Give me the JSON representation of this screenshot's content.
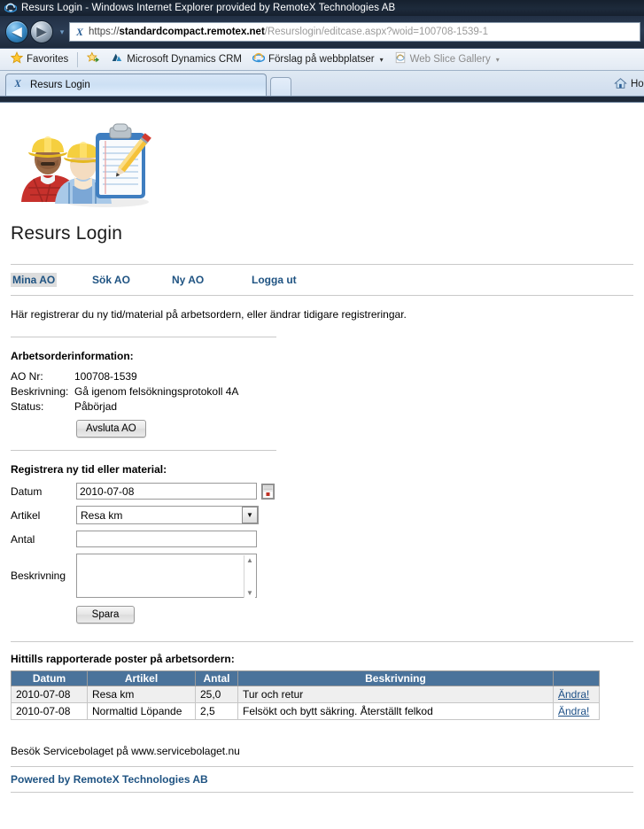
{
  "window": {
    "title": "Resurs Login - Windows Internet Explorer provided by RemoteX Technologies AB",
    "ie_icon": "internet-explorer-icon"
  },
  "toolbar": {
    "back_label": "◀",
    "forward_label": "▶",
    "history_caret": "▾",
    "address": {
      "scheme": "https://",
      "domain_prefix": "standardcompact.",
      "domain": "remotex.net",
      "path": "/Resurslogin/editcase.aspx?woid=100708-1539-1",
      "full_url": "https://standardcompact.remotex.net/Resurslogin/editcase.aspx?woid=100708-1539-1",
      "favicon_glyph": "X"
    }
  },
  "favorites_bar": {
    "favorites_label": "Favorites",
    "items": [
      {
        "label": "Microsoft Dynamics CRM",
        "icon": "dynamics-crm-icon",
        "has_caret": false,
        "dim": false
      },
      {
        "label": "Förslag på webbplatser",
        "icon": "internet-explorer-icon",
        "has_caret": true,
        "dim": false
      },
      {
        "label": "Web Slice Gallery",
        "icon": "web-slice-icon",
        "has_caret": true,
        "dim": true
      }
    ],
    "caret": "▾"
  },
  "tabs": {
    "active": {
      "label": "Resurs Login",
      "favicon_glyph": "X"
    },
    "new_tab_label": "",
    "home_label": "Ho"
  },
  "page": {
    "logo_alt": "workers-clipboard-logo",
    "title": "Resurs Login",
    "nav": [
      {
        "label": "Mina AO",
        "active": true
      },
      {
        "label": "Sök AO",
        "active": false
      },
      {
        "label": "Ny AO",
        "active": false
      },
      {
        "label": "Logga ut",
        "active": false
      }
    ],
    "intro": "Här registrerar du ny tid/material på arbetsordern, eller ändrar tidigare registreringar.",
    "workorder": {
      "heading": "Arbetsorderinformation:",
      "fields": [
        {
          "label": "AO Nr:",
          "value": "100708-1539"
        },
        {
          "label": "Beskrivning:",
          "value": "Gå igenom felsökningsprotokoll 4A"
        },
        {
          "label": "Status:",
          "value": "Påbörjad"
        }
      ],
      "close_button": "Avsluta AO"
    },
    "register": {
      "heading": "Registrera ny tid eller material:",
      "datum_label": "Datum",
      "datum_value": "2010-07-08",
      "datum_placeholder": "",
      "calendar_icon": "calendar-icon",
      "artikel_label": "Artikel",
      "artikel_value": "Resa km",
      "artikel_options": [
        "Resa km"
      ],
      "antal_label": "Antal",
      "antal_value": "",
      "antal_placeholder": "",
      "beskrivning_label": "Beskrivning",
      "beskrivning_value": "",
      "beskrivning_placeholder": "",
      "save_button": "Spara"
    },
    "reported": {
      "heading": "Hittills rapporterade poster på arbetsordern:",
      "columns": [
        "Datum",
        "Artikel",
        "Antal",
        "Beskrivning",
        ""
      ],
      "rows": [
        {
          "datum": "2010-07-08",
          "artikel": "Resa km",
          "antal": "25,0",
          "beskrivning": "Tur och retur",
          "action": "Ändra!"
        },
        {
          "datum": "2010-07-08",
          "artikel": "Normaltid Löpande",
          "antal": "2,5",
          "beskrivning": "Felsökt och bytt säkring. Återställt felkod",
          "action": "Ändra!"
        }
      ]
    },
    "footer_note": "Besök Servicebolaget på www.servicebolaget.nu",
    "powered_by": "Powered by RemoteX Technologies AB"
  },
  "colors": {
    "table_header_bg": "#4a739b",
    "link_blue": "#1f5382",
    "alt_row_bg": "#efefef",
    "chrome_dark": "#1c2737"
  }
}
